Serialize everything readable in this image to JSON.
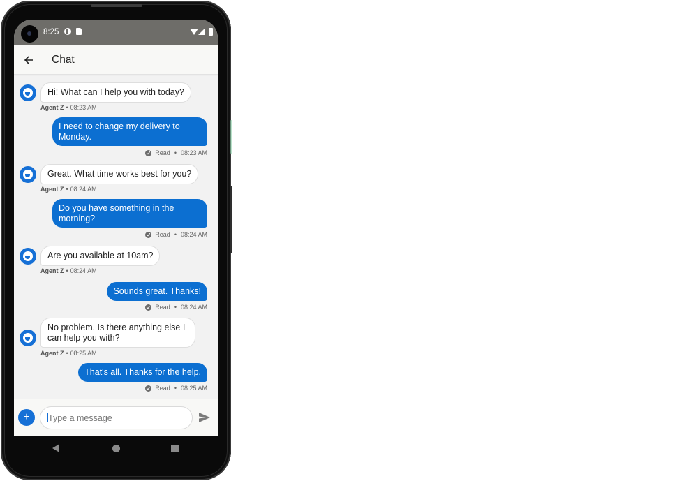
{
  "status_bar": {
    "time": "8:25",
    "icons": [
      "camera-cutout",
      "f-notification-icon",
      "sd-card-icon",
      "wifi-icon",
      "cell-signal-icon",
      "battery-icon"
    ]
  },
  "app_bar": {
    "back_icon": "arrow-left-icon",
    "title": "Chat"
  },
  "messages": [
    {
      "direction": "incoming",
      "text": "Hi! What can I help you with today?",
      "sender": "Agent Z",
      "time": "08:23 AM"
    },
    {
      "direction": "outgoing",
      "text": "I need to change my delivery to Monday.",
      "status": "Read",
      "time": "08:23 AM"
    },
    {
      "direction": "incoming",
      "text": "Great. What time works best for you?",
      "sender": "Agent Z",
      "time": "08:24 AM"
    },
    {
      "direction": "outgoing",
      "text": "Do you have something in the morning?",
      "status": "Read",
      "time": "08:24 AM"
    },
    {
      "direction": "incoming",
      "text": "Are you available at 10am?",
      "sender": "Agent Z",
      "time": "08:24 AM"
    },
    {
      "direction": "outgoing",
      "text": "Sounds great. Thanks!",
      "status": "Read",
      "time": "08:24 AM"
    },
    {
      "direction": "incoming",
      "text": "No problem. Is there anything else I can help you with?",
      "sender": "Agent Z",
      "time": "08:25 AM"
    },
    {
      "direction": "outgoing",
      "text": "That's all. Thanks for the help.",
      "status": "Read",
      "time": "08:25 AM"
    }
  ],
  "separator": "•",
  "composer": {
    "add_label": "+",
    "input_value": "",
    "input_placeholder": "Type a message",
    "send_icon": "send-icon"
  },
  "nav_bar": {
    "buttons": [
      "back",
      "home",
      "recents"
    ]
  },
  "colors": {
    "accent": "#0c6fd1",
    "status_bar": "#6e6d69",
    "chat_background": "#f2f2f2"
  }
}
